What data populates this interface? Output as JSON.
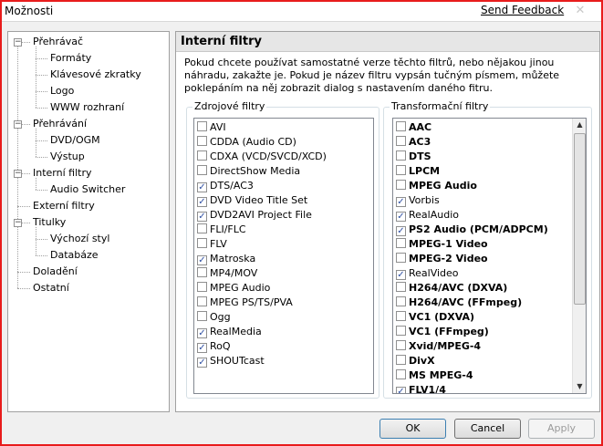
{
  "window": {
    "title": "Možnosti",
    "feedback_link": "Send Feedback",
    "close_glyph": "✕"
  },
  "tree": [
    {
      "label": "Přehrávač",
      "level": 0,
      "expander": "−"
    },
    {
      "label": "Formáty",
      "level": 1
    },
    {
      "label": "Klávesové zkratky",
      "level": 1
    },
    {
      "label": "Logo",
      "level": 1
    },
    {
      "label": "WWW rozhraní",
      "level": 1
    },
    {
      "label": "Přehrávání",
      "level": 0,
      "expander": "−"
    },
    {
      "label": "DVD/OGM",
      "level": 1
    },
    {
      "label": "Výstup",
      "level": 1
    },
    {
      "label": "Interní filtry",
      "level": 0,
      "expander": "−"
    },
    {
      "label": "Audio Switcher",
      "level": 1
    },
    {
      "label": "Externí filtry",
      "level": 0
    },
    {
      "label": "Titulky",
      "level": 0,
      "expander": "−"
    },
    {
      "label": "Výchozí styl",
      "level": 1
    },
    {
      "label": "Databáze",
      "level": 1
    },
    {
      "label": "Doladění",
      "level": 0
    },
    {
      "label": "Ostatní",
      "level": 0
    }
  ],
  "panel": {
    "title": "Interní filtry",
    "description": "Pokud chcete používat samostatné verze těchto filtrů, nebo nějakou jinou náhradu, zakažte je. Pokud je název filtru vypsán tučným písmem, můžete poklepáním na něj zobrazit dialog s nastavením daného fitru."
  },
  "source_filters": {
    "label": "Zdrojové filtry",
    "items": [
      {
        "label": "AVI",
        "checked": false
      },
      {
        "label": "CDDA (Audio CD)",
        "checked": false
      },
      {
        "label": "CDXA (VCD/SVCD/XCD)",
        "checked": false
      },
      {
        "label": "DirectShow Media",
        "checked": false
      },
      {
        "label": "DTS/AC3",
        "checked": true
      },
      {
        "label": "DVD Video Title Set",
        "checked": true
      },
      {
        "label": "DVD2AVI Project File",
        "checked": true
      },
      {
        "label": "FLI/FLC",
        "checked": false
      },
      {
        "label": "FLV",
        "checked": false
      },
      {
        "label": "Matroska",
        "checked": true
      },
      {
        "label": "MP4/MOV",
        "checked": false
      },
      {
        "label": "MPEG Audio",
        "checked": false
      },
      {
        "label": "MPEG PS/TS/PVA",
        "checked": false
      },
      {
        "label": "Ogg",
        "checked": false
      },
      {
        "label": "RealMedia",
        "checked": true
      },
      {
        "label": "RoQ",
        "checked": true
      },
      {
        "label": "SHOUTcast",
        "checked": true
      }
    ]
  },
  "transform_filters": {
    "label": "Transformační filtry",
    "items": [
      {
        "label": "AAC",
        "checked": false,
        "bold": true
      },
      {
        "label": "AC3",
        "checked": false,
        "bold": true
      },
      {
        "label": "DTS",
        "checked": false,
        "bold": true
      },
      {
        "label": "LPCM",
        "checked": false,
        "bold": true
      },
      {
        "label": "MPEG Audio",
        "checked": false,
        "bold": true
      },
      {
        "label": "Vorbis",
        "checked": true,
        "bold": false
      },
      {
        "label": "RealAudio",
        "checked": true,
        "bold": false
      },
      {
        "label": "PS2 Audio (PCM/ADPCM)",
        "checked": true,
        "bold": true
      },
      {
        "label": "MPEG-1 Video",
        "checked": false,
        "bold": true
      },
      {
        "label": "MPEG-2 Video",
        "checked": false,
        "bold": true
      },
      {
        "label": "RealVideo",
        "checked": true,
        "bold": false
      },
      {
        "label": "H264/AVC (DXVA)",
        "checked": false,
        "bold": true
      },
      {
        "label": "H264/AVC (FFmpeg)",
        "checked": false,
        "bold": true
      },
      {
        "label": "VC1 (DXVA)",
        "checked": false,
        "bold": true
      },
      {
        "label": "VC1 (FFmpeg)",
        "checked": false,
        "bold": true
      },
      {
        "label": "Xvid/MPEG-4",
        "checked": false,
        "bold": true
      },
      {
        "label": "DivX",
        "checked": false,
        "bold": true
      },
      {
        "label": "MS MPEG-4",
        "checked": false,
        "bold": true
      },
      {
        "label": "FLV1/4",
        "checked": true,
        "bold": true
      }
    ]
  },
  "buttons": {
    "ok": "OK",
    "cancel": "Cancel",
    "apply": "Apply"
  }
}
